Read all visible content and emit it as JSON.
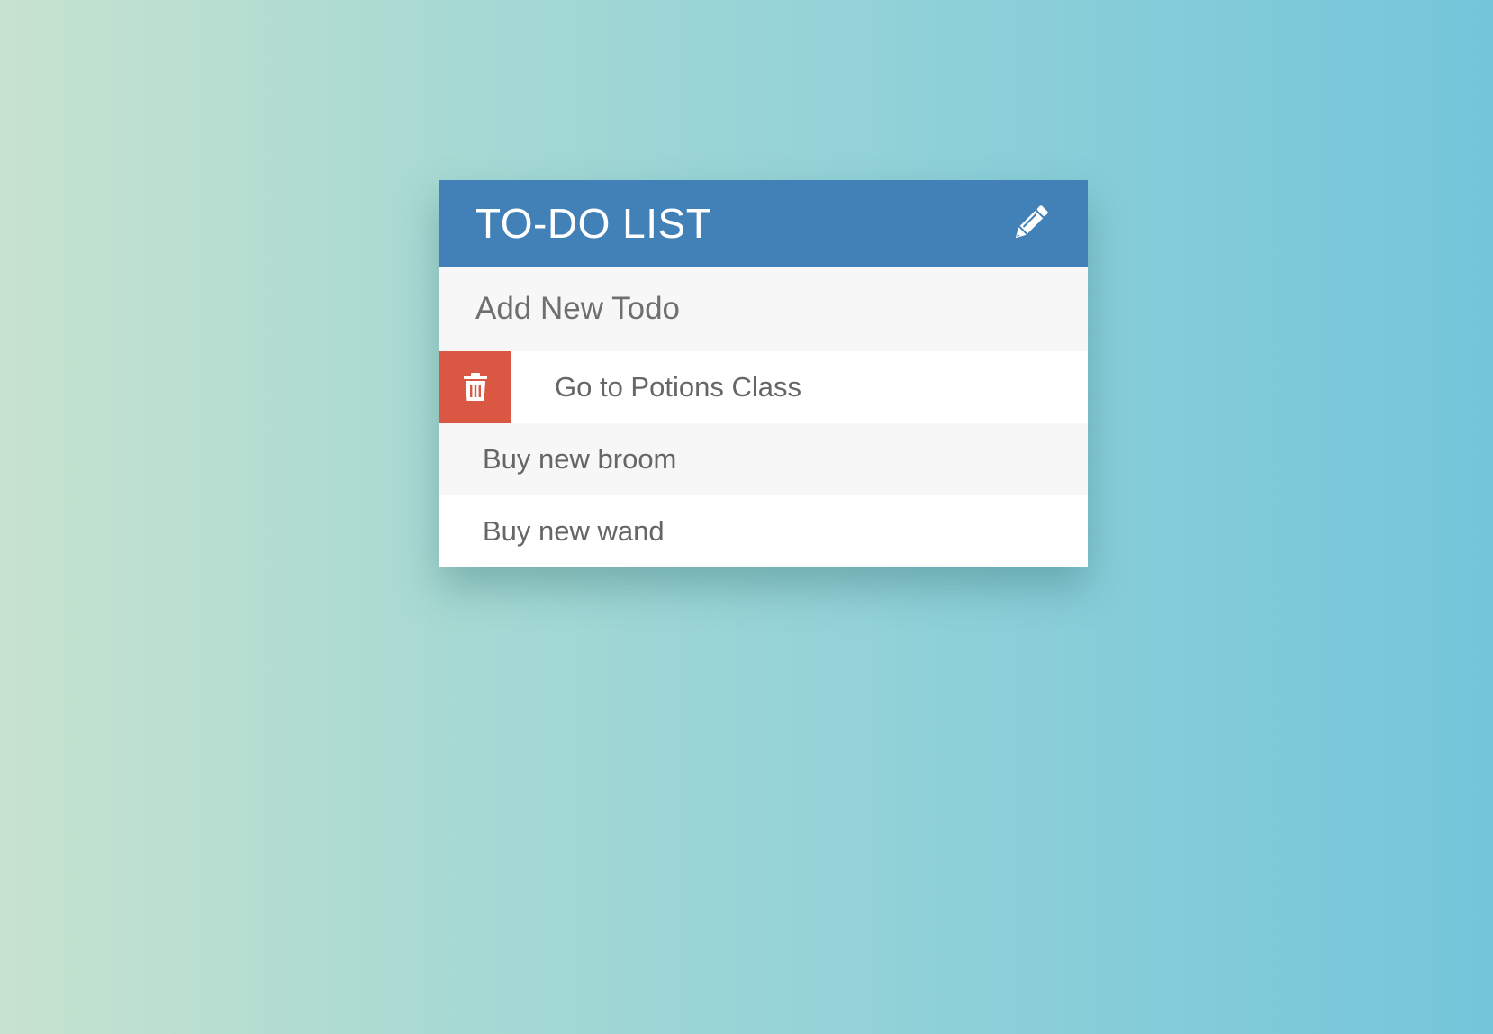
{
  "header": {
    "title": "TO-DO LIST",
    "toggle_icon": "pencil-icon"
  },
  "add_todo": {
    "placeholder": "Add New Todo"
  },
  "todos": [
    {
      "text": "Go to Potions Class",
      "delete_visible": true,
      "delete_icon": "trash-icon"
    },
    {
      "text": "Buy new broom",
      "delete_visible": false
    },
    {
      "text": "Buy new wand",
      "delete_visible": false
    }
  ],
  "colors": {
    "header": "#4281b7",
    "delete": "#d95743",
    "row_alt": "#f7f7f7",
    "text": "#666666"
  }
}
